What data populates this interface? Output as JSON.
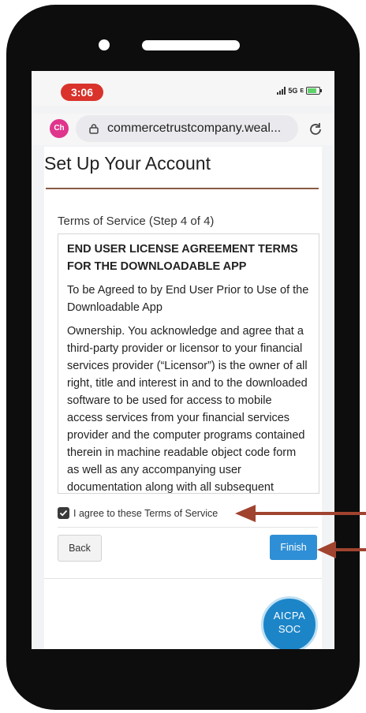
{
  "status_bar": {
    "time": "3:06",
    "network": "5G",
    "network_suffix": "E"
  },
  "browser": {
    "avatar_initials": "Ch",
    "url": "commercetrustcompany.weal..."
  },
  "page": {
    "title": "Set Up Your Account",
    "step_label": "Terms of Service (Step 4 of 4)"
  },
  "terms": {
    "heading": "END USER LICENSE AGREEMENT TERMS FOR THE DOWNLOADABLE APP",
    "paragraph_1": "To be Agreed to by End User Prior to Use of the Downloadable App",
    "paragraph_2": "Ownership. You acknowledge and agree that a third-party provider or licensor to your financial services provider (“Licensor”) is the owner of all right, title and interest in and to the downloaded software to be used for access to mobile access services from your financial services provider and the computer programs contained therein in machine readable object code form as well as any accompanying user documentation along with all subsequent"
  },
  "agreement": {
    "label": "I agree to these Terms of Service",
    "checked": true
  },
  "buttons": {
    "back_label": "Back",
    "finish_label": "Finish"
  },
  "badge": {
    "line_1": "AICPA",
    "line_2": "SOC"
  },
  "colors": {
    "time_pill": "#d9332b",
    "finish_button": "#2f8fd6",
    "title_rule": "#8a5a44",
    "annotation_arrow": "#a0432f",
    "aicpa_badge": "#1c85c8"
  }
}
